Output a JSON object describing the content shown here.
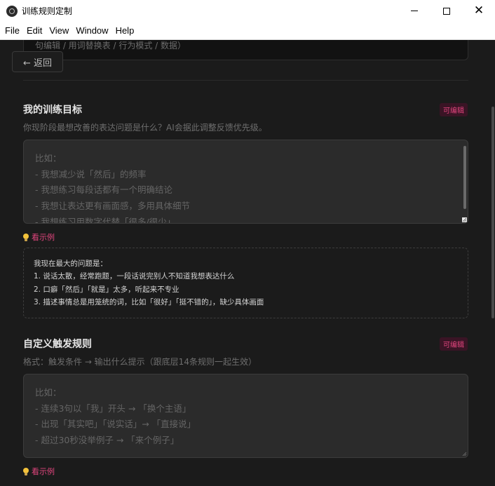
{
  "window": {
    "title": "训练规则定制",
    "minimize_icon": "minimize-icon",
    "maximize_icon": "maximize-icon",
    "close_icon": "close-icon",
    "close_glyph": "✕"
  },
  "menu": [
    "File",
    "Edit",
    "View",
    "Window",
    "Help"
  ],
  "previous_box_text": "句编辑 / 用词替换表 / 行为模式 / 数据）",
  "back_button": "← 返回",
  "goal_section": {
    "title": "我的训练目标",
    "badge": "可编辑",
    "description": "你现阶段最想改善的表达问题是什么？AI会据此调整反馈优先级。",
    "placeholder_lines": [
      "比如：",
      "- 我想减少说「然后」的频率",
      "- 我想练习每段话都有一个明确结论",
      "- 我想让表达更有画面感，多用具体细节",
      "- 我想练习用数字代替「很多/很少」"
    ],
    "example_link": "看示例",
    "example_lines": [
      "我现在最大的问题是：",
      "1. 说话太散，经常跑题，一段话说完别人不知道我想表达什么",
      "2. 口癖「然后」「就是」太多，听起来不专业",
      "3. 描述事情总是用笼统的词，比如「很好」「挺不错的」，缺少具体画面"
    ]
  },
  "trigger_section": {
    "title": "自定义触发规则",
    "badge": "可编辑",
    "description": "格式：触发条件 → 输出什么提示（跟底层14条规则一起生效）",
    "placeholder_lines": [
      "比如：",
      "- 连续3句以「我」开头 → 「换个主语」",
      "- 出现「其实吧」「说实话」→ 「直接说」",
      "- 超过30秒没举例子 → 「来个例子」"
    ],
    "example_link": "看示例"
  },
  "colors": {
    "accent": "#e0457d",
    "background": "#1b1b1b",
    "input_background": "#2b2b2b"
  }
}
